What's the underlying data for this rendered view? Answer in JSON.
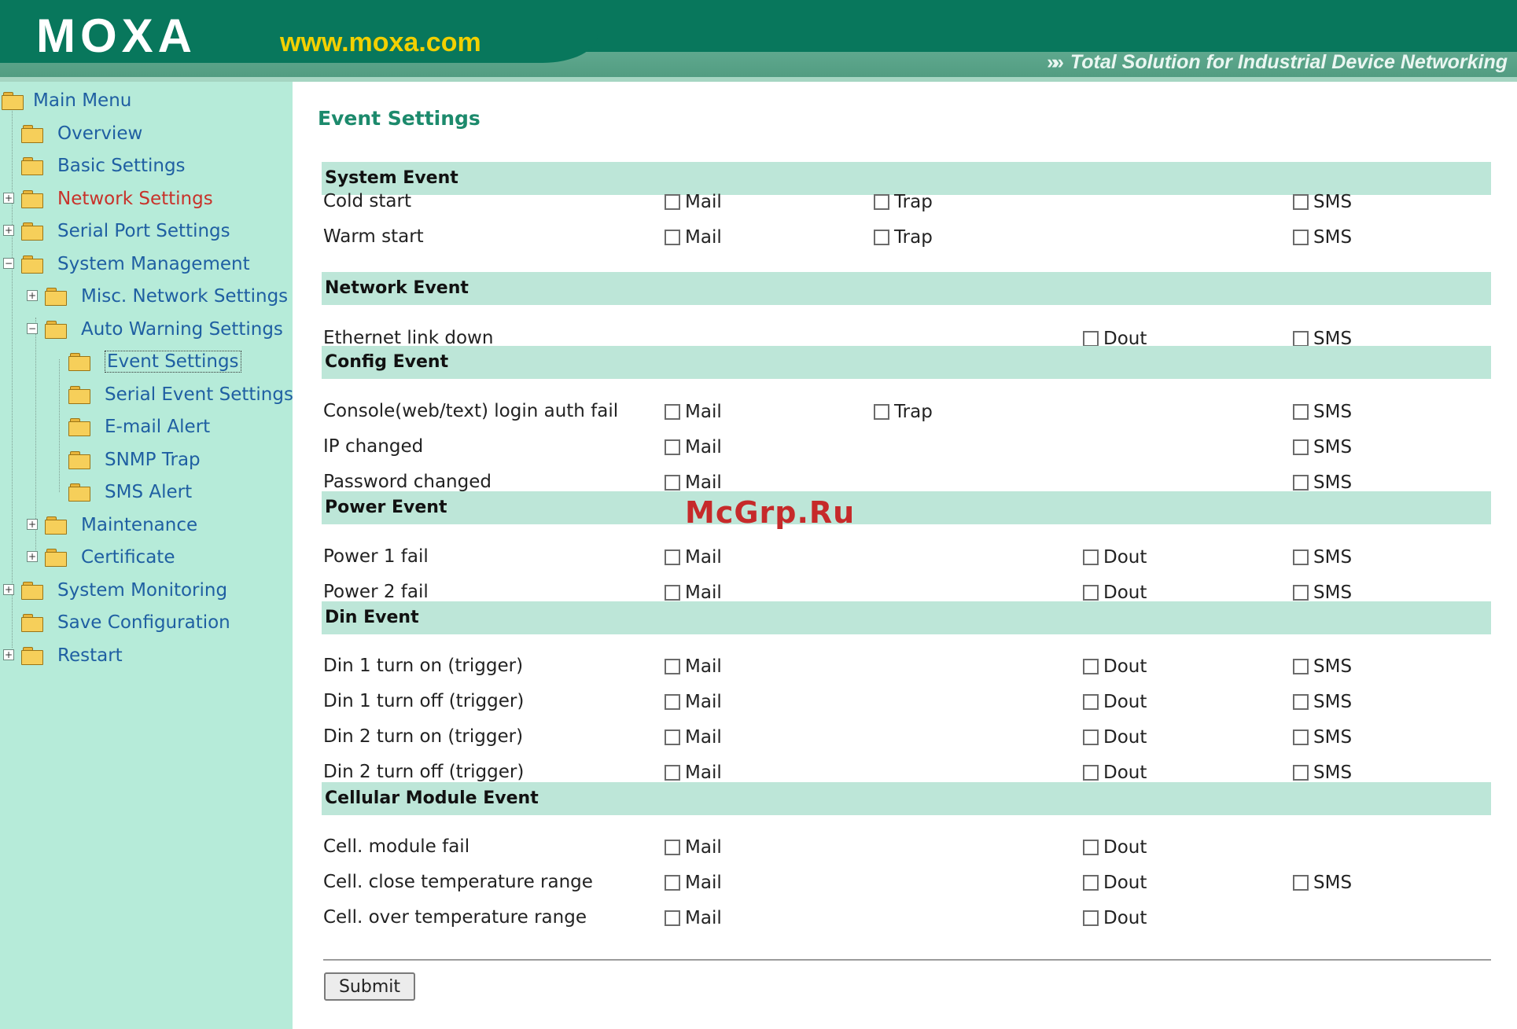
{
  "header": {
    "logo_text": "MOXA",
    "url_text": "www.moxa.com",
    "tagline": "Total Solution for Industrial Device Networking",
    "colors": {
      "band": "#08775c",
      "url": "#f2d000"
    }
  },
  "sidebar": {
    "items": [
      {
        "label": "Main Menu",
        "expander": ""
      },
      {
        "label": "Overview",
        "expander": ""
      },
      {
        "label": "Basic Settings",
        "expander": ""
      },
      {
        "label": "Network Settings",
        "expander": "+"
      },
      {
        "label": "Serial Port Settings",
        "expander": "+"
      },
      {
        "label": "System Management",
        "expander": "−"
      },
      {
        "label": "Misc. Network Settings",
        "expander": "+"
      },
      {
        "label": "Auto Warning Settings",
        "expander": "−"
      },
      {
        "label": "Event Settings",
        "expander": ""
      },
      {
        "label": "Serial Event Settings",
        "expander": ""
      },
      {
        "label": "E-mail Alert",
        "expander": ""
      },
      {
        "label": "SNMP Trap",
        "expander": ""
      },
      {
        "label": "SMS Alert",
        "expander": ""
      },
      {
        "label": "Maintenance",
        "expander": "+"
      },
      {
        "label": "Certificate",
        "expander": "+"
      },
      {
        "label": "System Monitoring",
        "expander": "+"
      },
      {
        "label": "Save Configuration",
        "expander": ""
      },
      {
        "label": "Restart",
        "expander": "+"
      }
    ],
    "icon": "folder-icon",
    "colors": {
      "background": "#b6ebd9",
      "link": "#1f5fa2",
      "active_link": "#c8322a"
    }
  },
  "main": {
    "title": "Event Settings",
    "option_labels": {
      "mail": "Mail",
      "trap": "Trap",
      "dout": "Dout",
      "sms": "SMS"
    },
    "sections": [
      {
        "title": "System Event",
        "rows": [
          {
            "label": "Cold start",
            "options": {
              "mail": false,
              "trap": false,
              "sms": false
            }
          },
          {
            "label": "Warm start",
            "options": {
              "mail": false,
              "trap": false,
              "sms": false
            }
          }
        ]
      },
      {
        "title": "Network Event",
        "rows": [
          {
            "label": "Ethernet link down",
            "options": {
              "dout": false,
              "sms": false
            }
          }
        ]
      },
      {
        "title": "Config Event",
        "rows": [
          {
            "label": "Console(web/text) login auth fail",
            "options": {
              "mail": false,
              "trap": false,
              "sms": false
            }
          },
          {
            "label": "IP changed",
            "options": {
              "mail": false,
              "sms": false
            }
          },
          {
            "label": "Password changed",
            "options": {
              "mail": false,
              "sms": false
            }
          }
        ]
      },
      {
        "title": "Power Event",
        "rows": [
          {
            "label": "Power 1 fail",
            "options": {
              "mail": false,
              "dout": false,
              "sms": false
            }
          },
          {
            "label": "Power 2 fail",
            "options": {
              "mail": false,
              "dout": false,
              "sms": false
            }
          }
        ]
      },
      {
        "title": "Din Event",
        "rows": [
          {
            "label": "Din 1 turn on (trigger)",
            "options": {
              "mail": false,
              "dout": false,
              "sms": false
            }
          },
          {
            "label": "Din 1 turn off (trigger)",
            "options": {
              "mail": false,
              "dout": false,
              "sms": false
            }
          },
          {
            "label": "Din 2 turn on (trigger)",
            "options": {
              "mail": false,
              "dout": false,
              "sms": false
            }
          },
          {
            "label": "Din 2 turn off (trigger)",
            "options": {
              "mail": false,
              "dout": false,
              "sms": false
            }
          }
        ]
      },
      {
        "title": "Cellular Module Event",
        "rows": [
          {
            "label": "Cell. module fail",
            "options": {
              "mail": false,
              "dout": false
            }
          },
          {
            "label": "Cell. close temperature range",
            "options": {
              "mail": false,
              "dout": false,
              "sms": false
            }
          },
          {
            "label": "Cell. over temperature range",
            "options": {
              "mail": false,
              "dout": false
            }
          }
        ]
      }
    ],
    "submit_label": "Submit",
    "colors": {
      "title": "#1c8a6c",
      "section_bg": "#bde6d8"
    }
  },
  "watermark": "McGrp.Ru"
}
